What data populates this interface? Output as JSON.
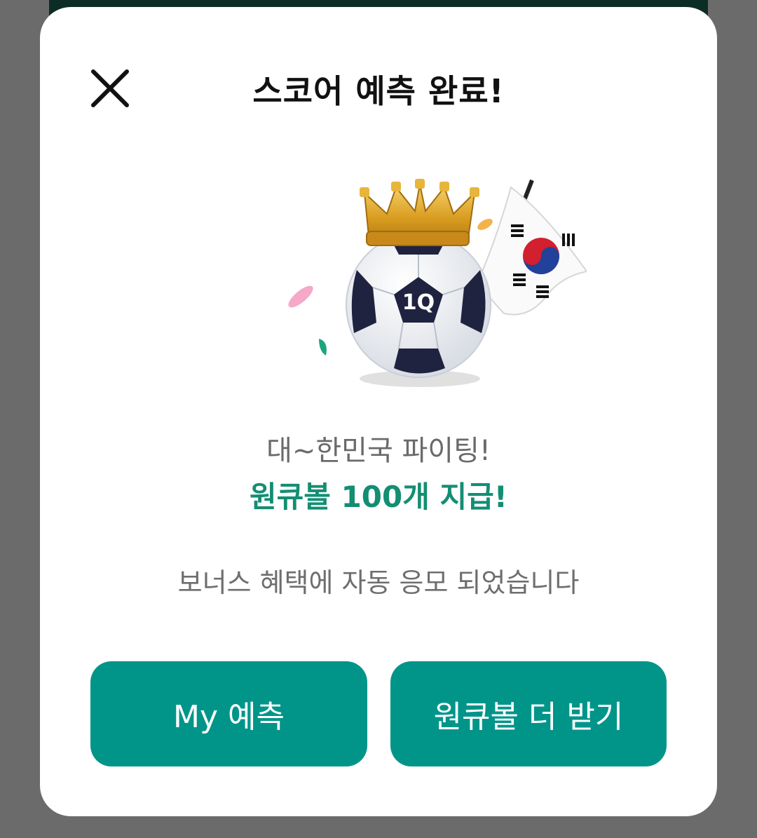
{
  "dialog": {
    "title": "스코어 예측 완료!",
    "close_icon": "close-icon",
    "hero_image": "crowned-soccer-ball-with-korean-flag",
    "ball_logo_text": "1Q",
    "message": "대~한민국 파이팅!",
    "reward": "원큐볼 100개 지급!",
    "notice": "보너스 혜택에 자동 응모 되었습니다",
    "buttons": {
      "my_prediction": "My 예측",
      "get_more": "원큐볼 더 받기"
    }
  },
  "colors": {
    "accent": "#01958a",
    "reward_text": "#138e73",
    "overlay": "#6b6b6b"
  }
}
